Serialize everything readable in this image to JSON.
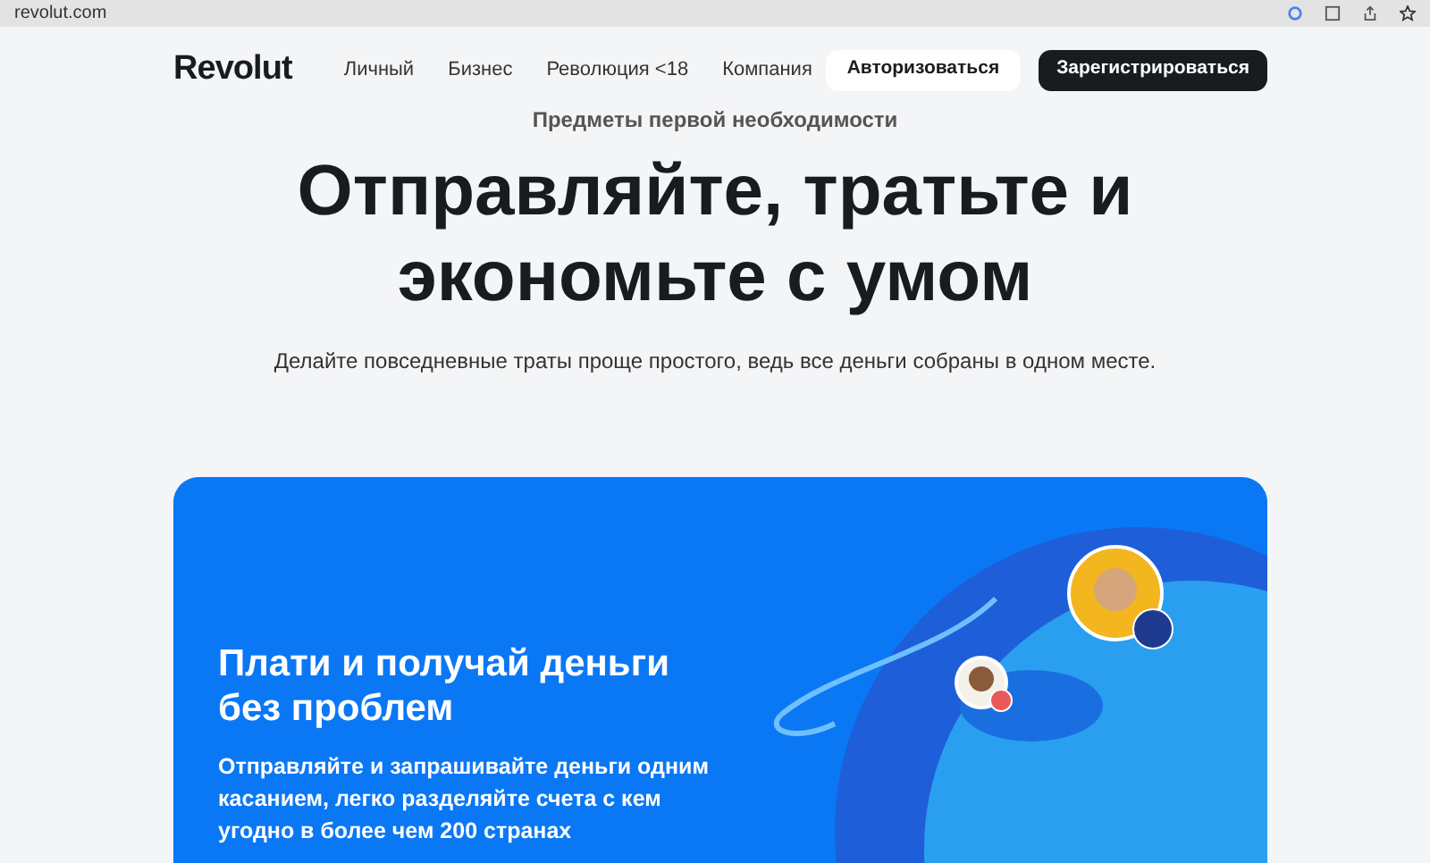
{
  "browser": {
    "url": "revolut.com"
  },
  "nav": {
    "logo": "Revolut",
    "links": [
      "Личный",
      "Бизнес",
      "Революция <18",
      "Компания"
    ],
    "login": "Авторизоваться",
    "signup": "Зарегистрироваться"
  },
  "hero": {
    "eyebrow": "Предметы первой необходимости",
    "title": "Отправляйте, тратьте и экономьте с умом",
    "subtitle": "Делайте повседневные траты проще простого, ведь все деньги собраны в одном месте."
  },
  "card": {
    "title": "Плати и получай деньги без проблем",
    "text": "Отправляйте и запрашивайте деньги одним касанием, легко разделяйте счета с кем угодно в более чем 200 странах"
  }
}
